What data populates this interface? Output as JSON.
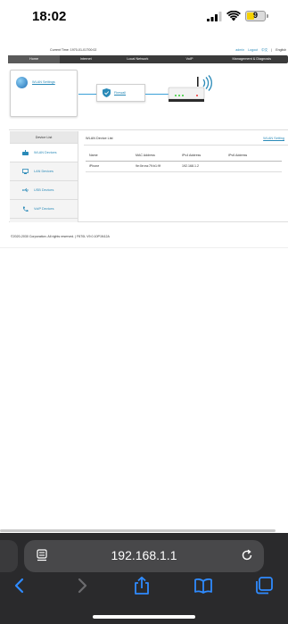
{
  "status_bar": {
    "time": "18:02",
    "battery": "9",
    "battery_color": "#f5d100"
  },
  "router_page": {
    "current_time": "Current Time: 1970-01-01T00:02",
    "admin_link": "admin",
    "logout_link": "Logout",
    "lang_current": "中文",
    "lang_english": "English",
    "nav_tabs": [
      "Home",
      "Internet",
      "Local Network",
      "VoIP",
      "Management & Diagnosis"
    ],
    "active_tab": "Home",
    "wlan_settings_label": "WLAN Settings",
    "firewall_label": "Firewall",
    "device_list_title": "Device List",
    "sidebar_items": [
      {
        "label": "WLAN Devices",
        "icon": "wlan-device-icon"
      },
      {
        "label": "LAN Devices",
        "icon": "lan-device-icon"
      },
      {
        "label": "USB Devices",
        "icon": "usb-icon"
      },
      {
        "label": "VoIP Devices",
        "icon": "phone-icon"
      }
    ],
    "wlan_device_list_header": "WLAN Device List",
    "wlan_setting_link": "WLAN Setting",
    "table_columns": [
      "Name",
      "MAC Address",
      "IPv4 Address",
      "IPv6 Address"
    ],
    "table_rows": [
      [
        "iPhone",
        "9e:0e:ea:79:b1:9f",
        "192.168.1.2",
        ""
      ]
    ],
    "footer": "©2020-2030 Corporation. All rights reserved.  |   F670L V9.0.10P1N12A",
    "accent_color": "#2a8ab8"
  },
  "safari": {
    "url": "192.168.1.1"
  }
}
